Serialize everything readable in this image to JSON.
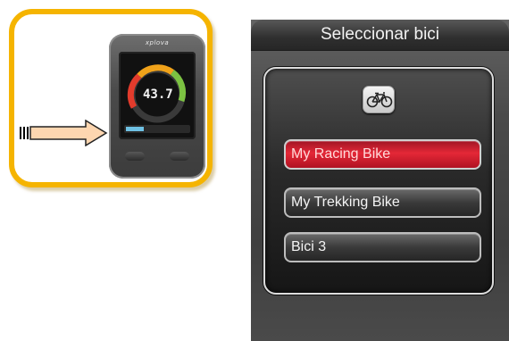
{
  "device_card": {
    "device": {
      "brand": "xplova",
      "readout": "43.7"
    },
    "arrow_icon": "right-arrow-icon"
  },
  "bike_select": {
    "title": "Seleccionar bici",
    "bike_icon": "bicycle-icon",
    "options": [
      {
        "label": "My Racing Bike",
        "selected": true
      },
      {
        "label": "My Trekking Bike",
        "selected": false
      },
      {
        "label": "Bici 3",
        "selected": false
      }
    ],
    "colors": {
      "selected": "#e42837",
      "accent": "#f5b400"
    }
  }
}
